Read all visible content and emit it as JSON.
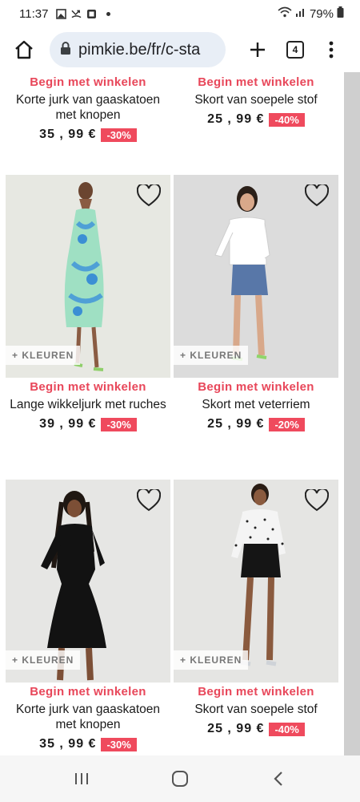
{
  "status": {
    "time": "11:37",
    "battery": "79%",
    "icons": [
      "image-icon",
      "missed-call-icon",
      "app-icon",
      "wifi-icon",
      "signal-icon",
      "battery-icon"
    ]
  },
  "browser": {
    "url": "pimkie.be/fr/c-sta",
    "tab_count": "4"
  },
  "products": [
    {
      "cta": "Begin met winkelen",
      "name": "Korte jurk van gaaskatoen met knopen",
      "price": "35 , 99 €",
      "discount": "-30%"
    },
    {
      "cta": "Begin met winkelen",
      "name": "Skort van soepele stof",
      "price": "25 , 99 €",
      "discount": "-40%"
    },
    {
      "cta": "Begin met winkelen",
      "name": "Lange wikkeljurk met ruches",
      "price": "39 , 99 €",
      "discount": "-30%",
      "colors": "+ KLEUREN"
    },
    {
      "cta": "Begin met winkelen",
      "name": "Skort met veterriem",
      "price": "25 , 99 €",
      "discount": "-20%",
      "colors": "+ KLEUREN"
    },
    {
      "cta": "Begin met winkelen",
      "name": "Korte jurk van gaaskatoen met knopen",
      "price": "35 , 99 €",
      "discount": "-30%",
      "colors": "+ KLEUREN"
    },
    {
      "cta": "Begin met winkelen",
      "name": "Skort van soepele stof",
      "price": "25 , 99 €",
      "discount": "-40%",
      "colors": "+ KLEUREN"
    }
  ],
  "colors": {
    "accent": "#e8475a",
    "badge": "#ef4a5d",
    "url_bar": "#e8eef6"
  }
}
